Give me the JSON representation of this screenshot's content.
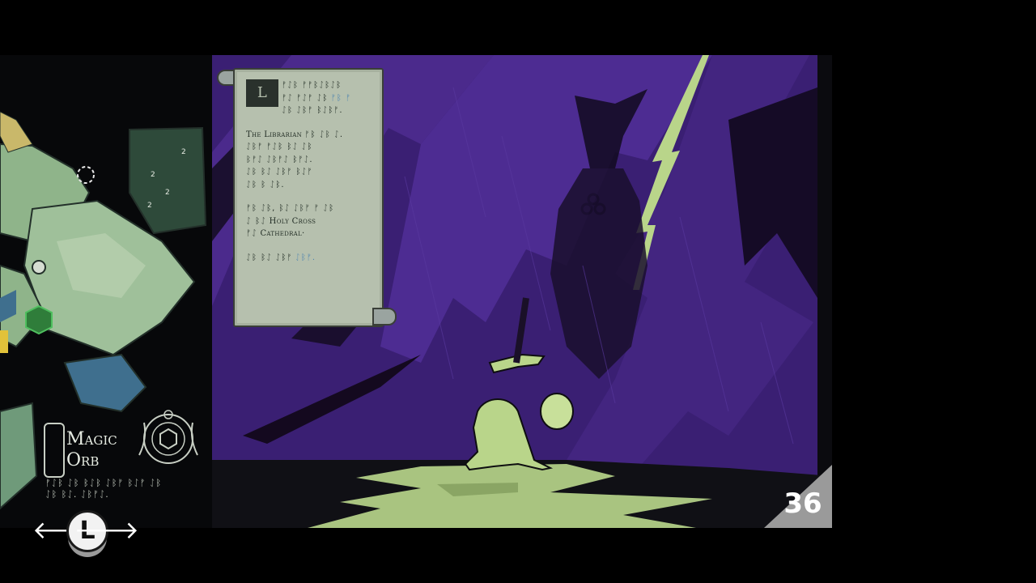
{
  "scroll": {
    "drop_cap": "L",
    "line1": "ᚠᛇᛒ ᚠᚠᛒᛇᛒᛇᛒ",
    "line2": "ᚠᛇ ᚠᛇᚠ ᛇᛒ",
    "line2_blue": "ᚠᛒ ᚠ",
    "line3": "ᛇᛒ ᛇᛒᚠ ᛒᛇᛒᚠ.",
    "librarian_label": "The Librarian",
    "librarian_runes": "ᚠᛒ ᛇᛒ ᛇ.",
    "p2_line2": "ᛇᛒᚠ ᚠᛇᛒ ᛒᛇ ᛇᛒ",
    "p2_line3": "ᛒᚠᛇ ᛇᛒᚠᛇ ᛒᚠᛇ.",
    "p2_line4": "ᛇᛒ ᛒᛇ ᛇᛒᚠ ᛒᛇᚠ",
    "p2_line5": "ᛇᛒ ᛒ ᛇᛒ.",
    "p3_line1": "ᚠᛒ ᛇᛒ, ᛒᛇ ᛇᛒᚠ ᚠ ᛇᛒ",
    "p3_line2_runes": "ᛇ ᛒᛇ",
    "holy_cross": "Holy Cross",
    "p3_line3_runes": "ᚠᛇ",
    "cathedral": "Cathedral",
    "p4_line1": "ᛇᛒ ᛒᛇ ᛇᛒᚠ",
    "p4_line1_blue": "ᛇᛒᚠ."
  },
  "item": {
    "name_line1": "Magic",
    "name_line2": "Orb",
    "desc_line1": "ᚠᛇᛒ ᛇᛒ ᛒᛇᛒ ᛇᛒᚠ ᛒᛇᚠ ᛇᛒ",
    "desc_line2": "ᛇᛒ ᛒᛇ. ᛇᛒᚠᛇ."
  },
  "page_number": "36",
  "nav": {
    "button_label": "L",
    "left_arrow": "🡐",
    "right_arrow": "🡒"
  },
  "colors": {
    "purple": "#4b2a8c",
    "dark_purple": "#2b1657",
    "lime": "#b9d58a",
    "parchment": "#b6c0ae",
    "map_green": "#8fb48a",
    "water": "#3f6f8e"
  }
}
